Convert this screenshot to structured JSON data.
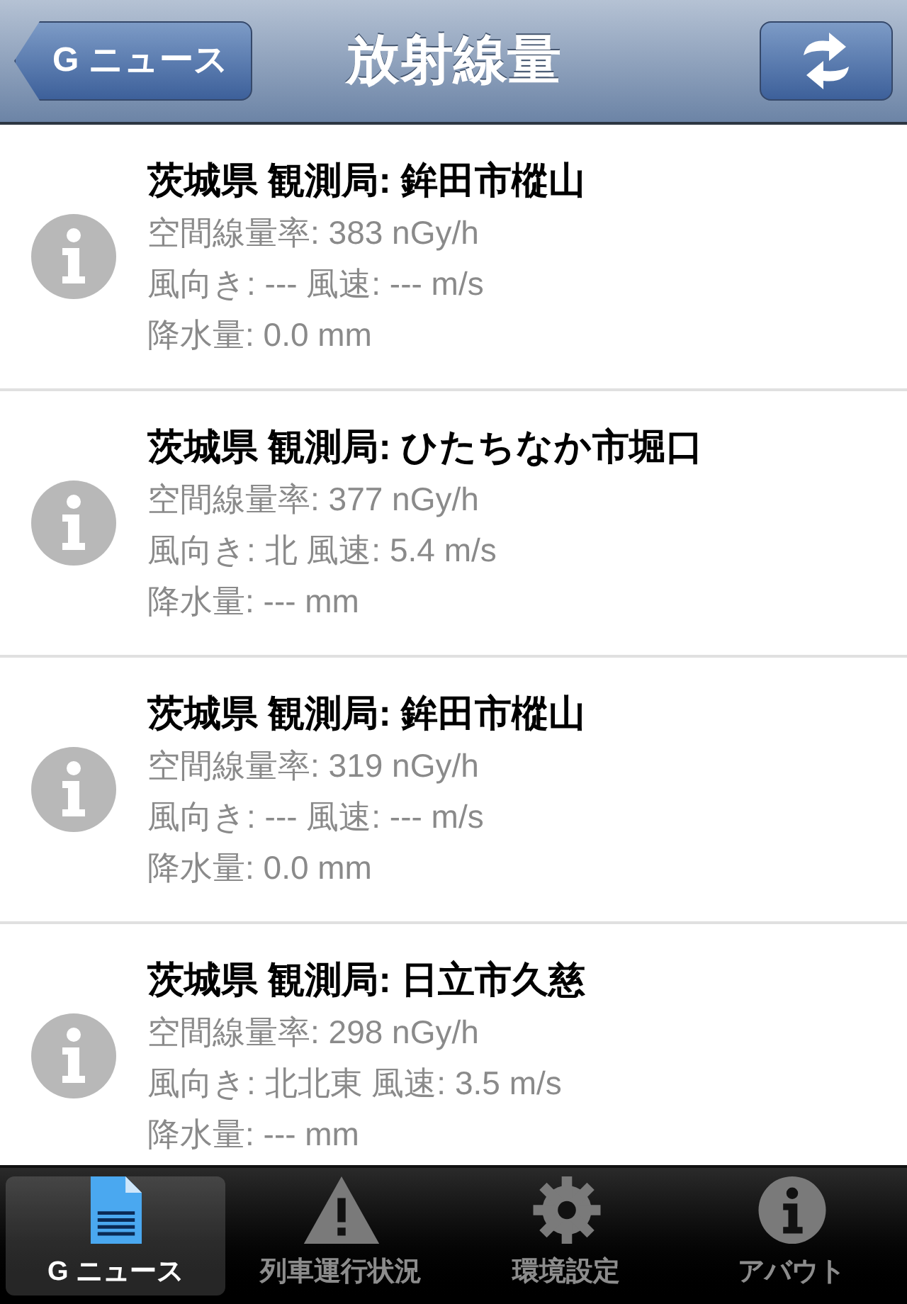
{
  "nav": {
    "back": "G ニュース",
    "title": "放射線量"
  },
  "rows": [
    {
      "title": "茨城県 観測局: 鉾田市樅山",
      "lines": [
        "空間線量率: 383 nGy/h",
        "風向き: --- 風速: --- m/s",
        "降水量: 0.0 mm"
      ]
    },
    {
      "title": "茨城県 観測局: ひたちなか市堀口",
      "lines": [
        "空間線量率: 377 nGy/h",
        "風向き: 北 風速: 5.4 m/s",
        "降水量: --- mm"
      ]
    },
    {
      "title": "茨城県 観測局: 鉾田市樅山",
      "lines": [
        "空間線量率: 319 nGy/h",
        "風向き: --- 風速: --- m/s",
        "降水量: 0.0 mm"
      ]
    },
    {
      "title": "茨城県 観測局: 日立市久慈",
      "lines": [
        "空間線量率: 298 nGy/h",
        "風向き: 北北東 風速: 3.5 m/s",
        "降水量: --- mm"
      ]
    }
  ],
  "tabs": [
    {
      "label": "G ニュース",
      "kind": "document",
      "selected": true
    },
    {
      "label": "列車運行状況",
      "kind": "warning",
      "selected": false
    },
    {
      "label": "環境設定",
      "kind": "gear",
      "selected": false
    },
    {
      "label": "アバウト",
      "kind": "info",
      "selected": false
    }
  ]
}
